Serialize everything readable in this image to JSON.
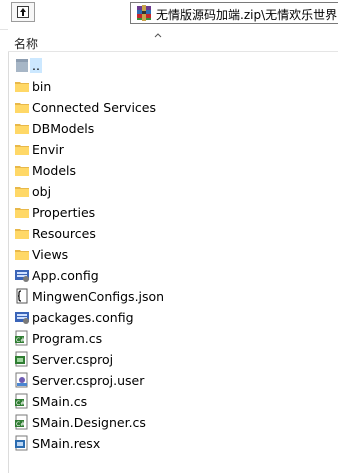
{
  "path": {
    "text": "无情版源码加端.zip\\无情欢乐世界"
  },
  "header": {
    "name_col": "名称"
  },
  "items": [
    {
      "label": "..",
      "type": "parent",
      "top": 0
    },
    {
      "label": "bin",
      "type": "folder"
    },
    {
      "label": "Connected Services",
      "type": "folder"
    },
    {
      "label": "DBModels",
      "type": "folder"
    },
    {
      "label": "Envir",
      "type": "folder"
    },
    {
      "label": "Models",
      "type": "folder"
    },
    {
      "label": "obj",
      "type": "folder"
    },
    {
      "label": "Properties",
      "type": "folder"
    },
    {
      "label": "Resources",
      "type": "folder"
    },
    {
      "label": "Views",
      "type": "folder"
    },
    {
      "label": "App.config",
      "type": "config"
    },
    {
      "label": "MingwenConfigs.json",
      "type": "json"
    },
    {
      "label": "packages.config",
      "type": "config"
    },
    {
      "label": "Program.cs",
      "type": "cs"
    },
    {
      "label": "Server.csproj",
      "type": "csproj"
    },
    {
      "label": "Server.csproj.user",
      "type": "user"
    },
    {
      "label": "SMain.cs",
      "type": "cs"
    },
    {
      "label": "SMain.Designer.cs",
      "type": "cs"
    },
    {
      "label": "SMain.resx",
      "type": "resx"
    }
  ],
  "colors": {
    "folder": "#ffd867",
    "selection": "#cce8ff"
  }
}
